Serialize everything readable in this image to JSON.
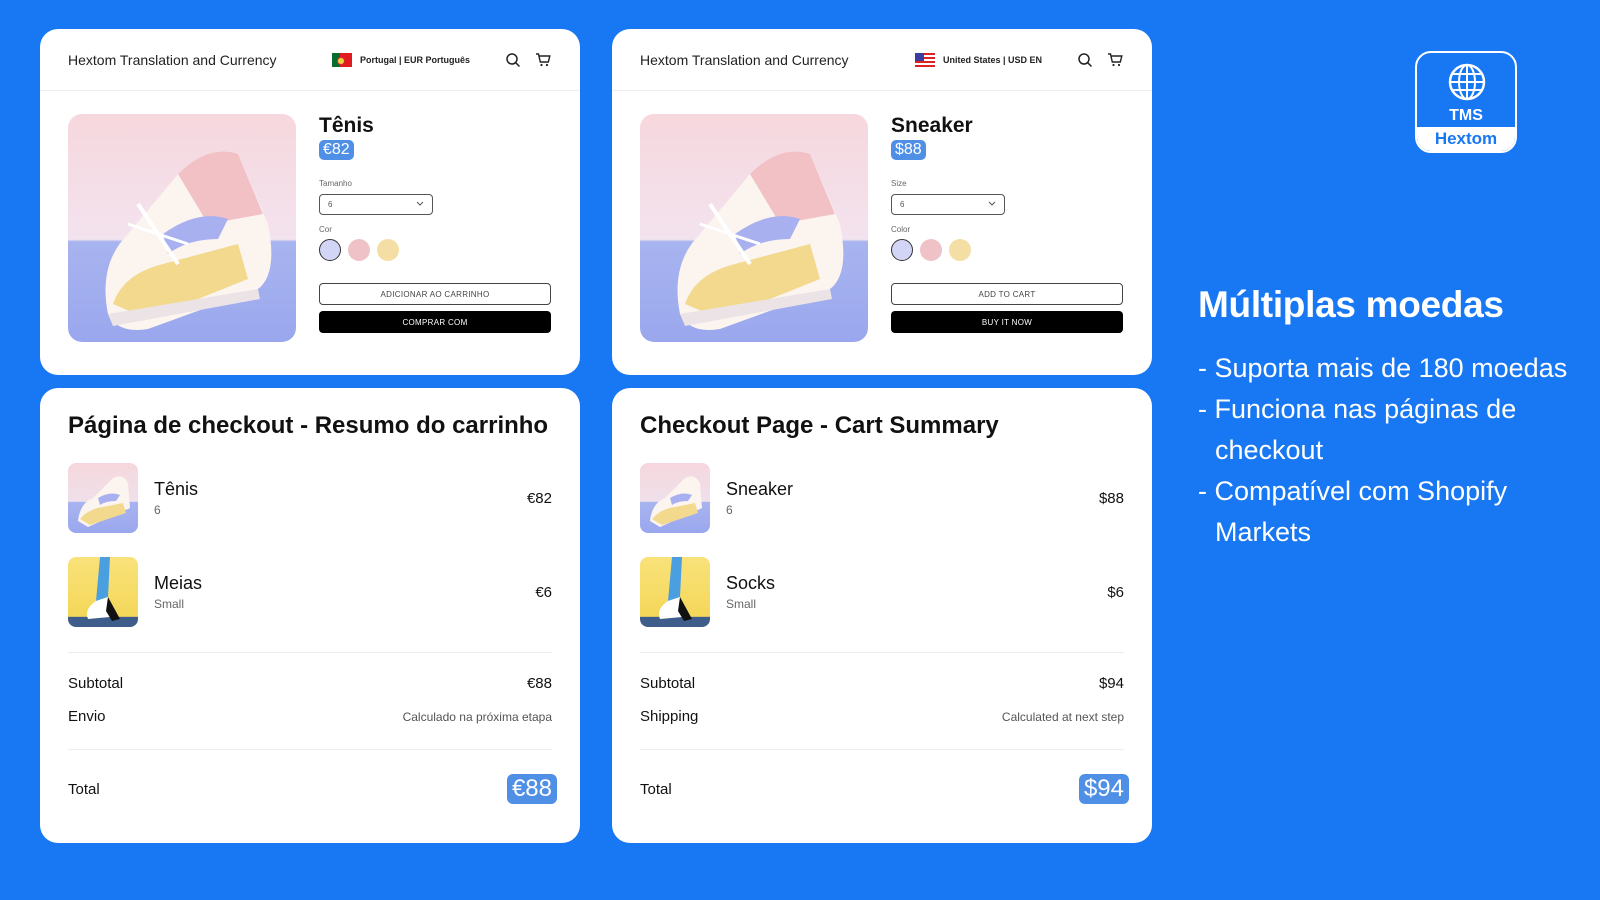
{
  "stores": {
    "pt": {
      "title": "Hextom Translation and Currency",
      "locale": "Portugal | EUR Português",
      "product_name": "Tênis",
      "price": "€82",
      "size_label": "Tamanho",
      "size_value": "6",
      "color_label": "Cor",
      "swatches": [
        "#d3d5f7",
        "#eec2c6",
        "#f5dea4"
      ],
      "add_to_cart": "ADICIONAR AO CARRINHO",
      "buy_now": "COMPRAR COM"
    },
    "us": {
      "title": "Hextom Translation and Currency",
      "locale": "United States | USD EN",
      "product_name": "Sneaker",
      "price": "$88",
      "size_label": "Size",
      "size_value": "6",
      "color_label": "Color",
      "swatches": [
        "#d3d5f7",
        "#eec2c6",
        "#f5dea4"
      ],
      "add_to_cart": "ADD TO CART",
      "buy_now": "BUY IT NOW"
    }
  },
  "checkouts": {
    "pt": {
      "title": "Página de checkout - Resumo do carrinho",
      "items": [
        {
          "name": "Tênis",
          "variant": "6",
          "price": "€82"
        },
        {
          "name": "Meias",
          "variant": "Small",
          "price": "€6"
        }
      ],
      "subtotal_label": "Subtotal",
      "subtotal_value": "€88",
      "shipping_label": "Envio",
      "shipping_value": "Calculado na próxima etapa",
      "total_label": "Total",
      "total_value": "€88"
    },
    "us": {
      "title": "Checkout Page - Cart Summary",
      "items": [
        {
          "name": "Sneaker",
          "variant": "6",
          "price": "$88"
        },
        {
          "name": "Socks",
          "variant": "Small",
          "price": "$6"
        }
      ],
      "subtotal_label": "Subtotal",
      "subtotal_value": "$94",
      "shipping_label": "Shipping",
      "shipping_value": "Calculated at next step",
      "total_label": "Total",
      "total_value": "$94"
    }
  },
  "logo": {
    "icon": "globe-icon",
    "acronym": "TMS",
    "brand": "Hextom"
  },
  "promo": {
    "title": "Múltiplas moedas",
    "bullets": [
      "- Suporta mais de 180 moedas",
      "- Funciona nas páginas de checkout",
      "- Compatível com Shopify Markets"
    ]
  },
  "colors": {
    "background": "#1877f2",
    "price_badge": "#4f8fe6"
  }
}
